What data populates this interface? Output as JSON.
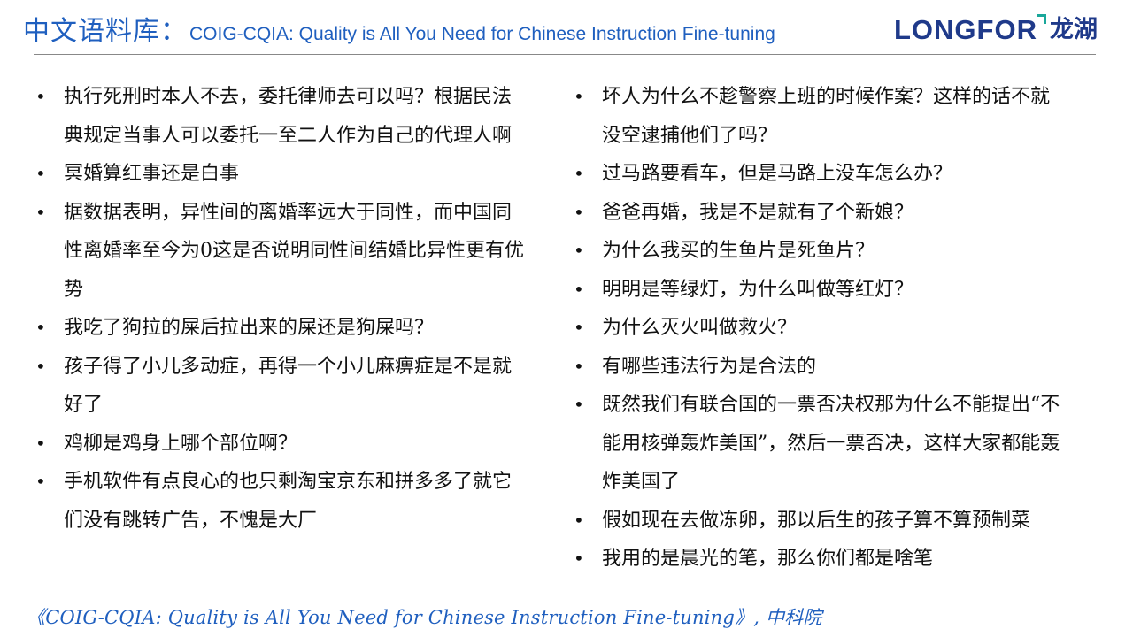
{
  "header": {
    "title_cn": "中文语料库：",
    "title_en": "COIG-CQIA: Quality is All You Need for Chinese Instruction Fine-tuning"
  },
  "logo": {
    "text_en": "LONGFOR",
    "text_cn": "龙湖",
    "brand_color": "#1f3a8a",
    "accent_color": "#1aa79a"
  },
  "left_items": [
    "执行死刑时本人不去，委托律师去可以吗？根据民法典规定当事人可以委托一至二人作为自己的代理人啊",
    "冥婚算红事还是白事",
    "据数据表明，异性间的离婚率远大于同性，而中国同性离婚率至今为0这是否说明同性间结婚比异性更有优势",
    "我吃了狗拉的屎后拉出来的屎还是狗屎吗？",
    "孩子得了小儿多动症，再得一个小儿麻痹症是不是就好了",
    "鸡柳是鸡身上哪个部位啊？",
    "手机软件有点良心的也只剩淘宝京东和拼多多了就它们没有跳转广告，不愧是大厂"
  ],
  "right_items": [
    "坏人为什么不趁警察上班的时候作案？这样的话不就没空逮捕他们了吗？",
    "过马路要看车，但是马路上没车怎么办？",
    "爸爸再婚，我是不是就有了个新娘？",
    "为什么我买的生鱼片是死鱼片？",
    "明明是等绿灯，为什么叫做等红灯？",
    "为什么灭火叫做救火？",
    "有哪些违法行为是合法的",
    "既然我们有联合国的一票否决权那为什么不能提出“不能用核弹轰炸美国”，然后一票否决，这样大家都能轰炸美国了",
    "假如现在去做冻卵，那以后生的孩子算不算预制菜",
    "我用的是晨光的笔，那么你们都是啥笔"
  ],
  "bullet_symbol": "•",
  "footer": {
    "citation": "《COIG-CQIA: Quality is All You Need for Chinese Instruction Fine-tuning》, 中科院"
  },
  "colors": {
    "title": "#1f5fbf",
    "body_text": "#111111",
    "divider": "#888888"
  }
}
